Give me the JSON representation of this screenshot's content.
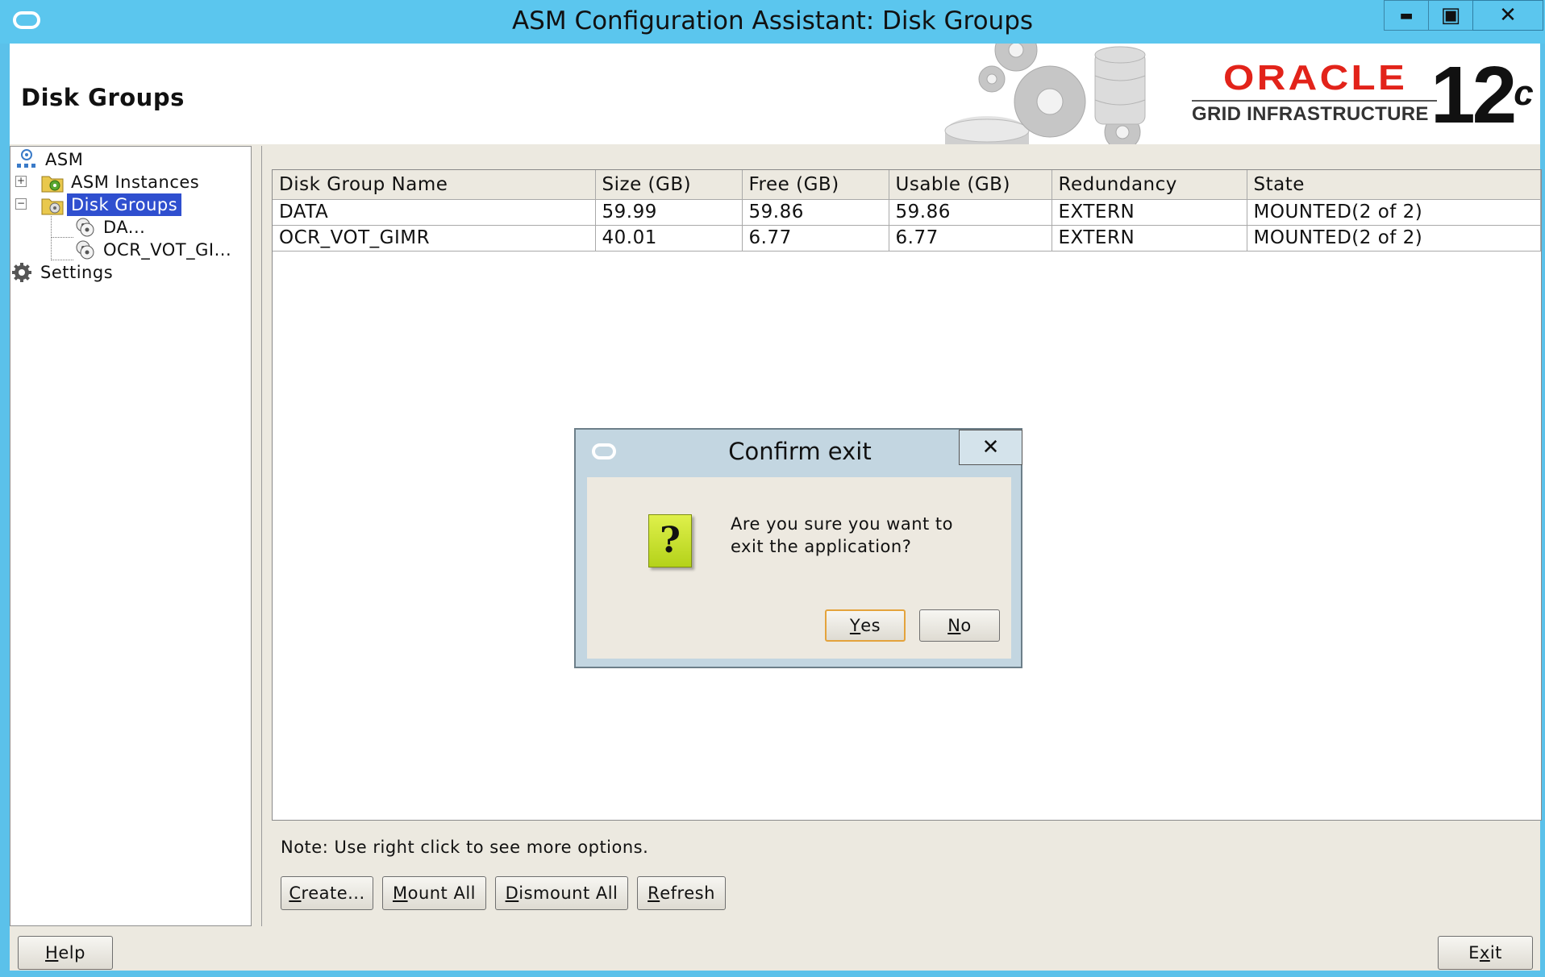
{
  "window": {
    "title": "ASM Configuration Assistant: Disk Groups",
    "minimize_glyph": "▬",
    "maximize_glyph": "▣",
    "close_glyph": "✕"
  },
  "header": {
    "page_title": "Disk Groups",
    "brand_logo": "ORACLE",
    "brand_product": "GRID INFRASTRUCTURE",
    "brand_version": "12",
    "brand_version_suffix": "c"
  },
  "tree": {
    "root": "ASM",
    "instances": "ASM Instances",
    "disk_groups": "Disk Groups",
    "child_1": "DA...",
    "child_2": "OCR_VOT_GI...",
    "settings": "Settings"
  },
  "table": {
    "columns": [
      "Disk Group Name",
      "Size (GB)",
      "Free (GB)",
      "Usable (GB)",
      "Redundancy",
      "State"
    ],
    "rows": [
      [
        "DATA",
        "59.99",
        "59.86",
        "59.86",
        "EXTERN",
        "MOUNTED(2 of 2)"
      ],
      [
        "OCR_VOT_GIMR",
        "40.01",
        "6.77",
        "6.77",
        "EXTERN",
        "MOUNTED(2 of 2)"
      ]
    ]
  },
  "note": "Note: Use right click to see more options.",
  "actions": {
    "create_mn": "C",
    "create_rest": "reate...",
    "mount_mn": "M",
    "mount_rest": "ount All",
    "dismount_mn": "D",
    "dismount_rest": "ismount All",
    "refresh_mn": "R",
    "refresh_rest": "efresh"
  },
  "footer": {
    "help_mn": "H",
    "help_rest": "elp",
    "exit_pre": "E",
    "exit_mn": "x",
    "exit_rest": "it"
  },
  "dialog": {
    "title": "Confirm exit",
    "close_glyph": "✕",
    "icon_glyph": "?",
    "message": "Are you sure you want to exit the application?",
    "yes_mn": "Y",
    "yes_rest": "es",
    "no_mn": "N",
    "no_rest": "o"
  },
  "colors": {
    "titlebar": "#5bc6ee",
    "selection": "#2f4fcf",
    "oracle_red": "#e2231a",
    "default_button_border": "#e4a33c"
  }
}
